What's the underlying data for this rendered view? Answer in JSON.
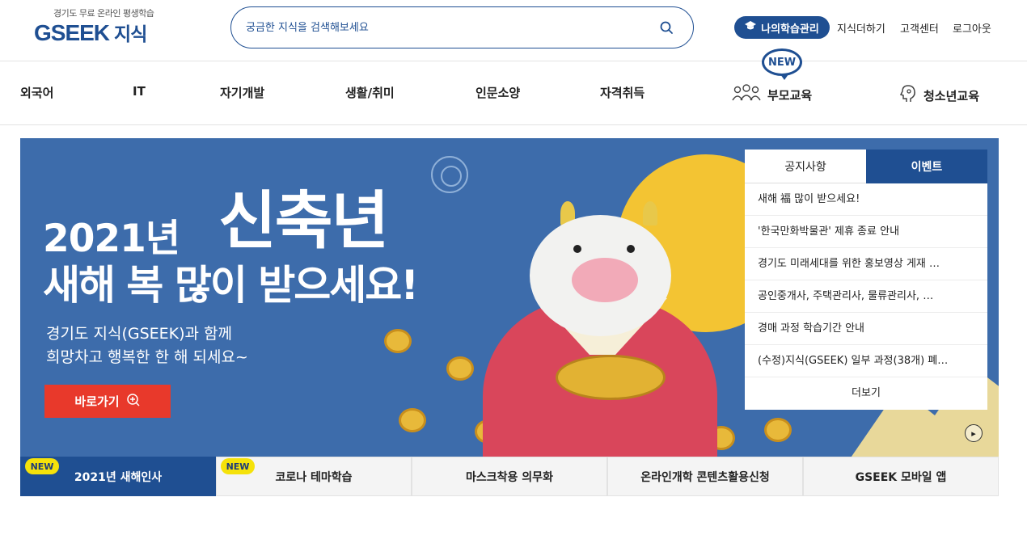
{
  "header": {
    "logo_tagline": "경기도 무료 온라인 평생학습",
    "logo_text": "GSEEK",
    "logo_kr": "지식",
    "search_placeholder": "궁금한 지식을 검색해보세요",
    "my_learning": "나의학습관리",
    "links": [
      "지식더하기",
      "고객센터",
      "로그아웃"
    ]
  },
  "gnb": {
    "items": [
      "외국어",
      "IT",
      "자기개발",
      "생활/취미",
      "인문소양",
      "자격취득",
      "부모교육",
      "청소년교육"
    ],
    "new_badge": "NEW"
  },
  "banner": {
    "year": "2021년",
    "big": "신축년",
    "title2": "새해 복 많이 받으세요!",
    "desc_line1": "경기도 지식(GSEEK)과 함께",
    "desc_line2": "희망차고 행복한 한 해 되세요~",
    "button": "바로가기"
  },
  "notice": {
    "tabs": [
      "공지사항",
      "이벤트"
    ],
    "active_tab": "이벤트",
    "items": [
      "새해 福 많이 받으세요!",
      "'한국만화박물관' 제휴 종료 안내",
      "경기도 미래세대를 위한 홍보영상 게재 …",
      "공인중개사, 주택관리사, 물류관리사, …",
      "경매 과정 학습기간 안내",
      "(수정)지식(GSEEK) 일부 과정(38개) 폐…"
    ],
    "more": "더보기"
  },
  "tabs": {
    "items": [
      "2021년 새해인사",
      "코로나 테마학습",
      "마스크착용 의무화",
      "온라인개학 콘텐츠활용신청",
      "GSEEK 모바일 앱"
    ],
    "new_label": "NEW"
  },
  "colors": {
    "brand": "#1f4f92",
    "banner_bg": "#3d6cab",
    "cta": "#e8392b",
    "new_badge": "#f5e20a"
  }
}
